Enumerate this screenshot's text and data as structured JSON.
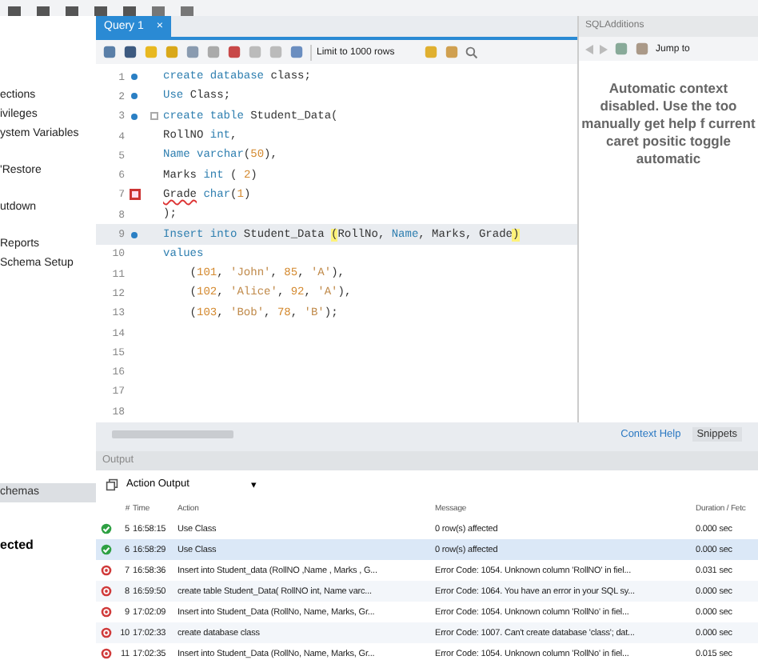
{
  "sidebar": {
    "groups": [
      {
        "items": [
          {
            "label": "ections"
          },
          {
            "label": "ivileges"
          },
          {
            "label": "ystem Variables"
          }
        ]
      },
      {
        "items": [
          {
            "label": "'Restore"
          }
        ]
      },
      {
        "items": [
          {
            "label": "utdown"
          }
        ]
      },
      {
        "items": [
          {
            "label": "Reports"
          },
          {
            "label": "Schema Setup"
          }
        ]
      }
    ],
    "schemas_tab": "chemas",
    "status": "ected"
  },
  "query_tab": {
    "label": "Query 1",
    "close": "×",
    "selected": true
  },
  "editor_toolbar": {
    "limit": "Limit to 1000 rows"
  },
  "lines": [
    {
      "n": "1",
      "kind": "statement",
      "tokens": [
        {
          "text": "create database ",
          "kind": "keyword"
        },
        {
          "text": "class;",
          "kind": "plain"
        }
      ]
    },
    {
      "n": "2",
      "kind": "statement",
      "tokens": [
        {
          "text": "Use ",
          "kind": "keyword"
        },
        {
          "text": "Class;",
          "kind": "plain"
        }
      ]
    },
    {
      "n": "3",
      "kind": "statement",
      "fold": true,
      "tokens": [
        {
          "text": "create table ",
          "kind": "keyword"
        },
        {
          "text": "Student_Data(",
          "kind": "plain"
        }
      ]
    },
    {
      "n": "4",
      "kind": "plain",
      "tokens": [
        {
          "text": "RollNO ",
          "kind": "plain"
        },
        {
          "text": "int",
          "kind": "keyword"
        },
        {
          "text": ",",
          "kind": "plain"
        }
      ]
    },
    {
      "n": "5",
      "kind": "plain",
      "tokens": [
        {
          "text": "Name ",
          "kind": "keyword"
        },
        {
          "text": "varchar",
          "kind": "keyword"
        },
        {
          "text": "(",
          "kind": "plain"
        },
        {
          "text": "50",
          "kind": "number"
        },
        {
          "text": "),",
          "kind": "plain"
        }
      ]
    },
    {
      "n": "6",
      "kind": "plain",
      "tokens": [
        {
          "text": "Marks ",
          "kind": "plain"
        },
        {
          "text": "int",
          "kind": "keyword"
        },
        {
          "text": " ( ",
          "kind": "plain"
        },
        {
          "text": "2",
          "kind": "number"
        },
        {
          "text": ")",
          "kind": "plain"
        }
      ]
    },
    {
      "n": "7",
      "kind": "error",
      "tokens": [
        {
          "text": "Grade",
          "kind": "error"
        },
        {
          "text": " char",
          "kind": "keyword"
        },
        {
          "text": "(",
          "kind": "plain"
        },
        {
          "text": "1",
          "kind": "number"
        },
        {
          "text": ")",
          "kind": "plain"
        }
      ]
    },
    {
      "n": "8",
      "kind": "plain",
      "tokens": [
        {
          "text": ");",
          "kind": "plain"
        }
      ]
    },
    {
      "n": "9",
      "kind": "statement",
      "current": true,
      "tokens": [
        {
          "text": "Insert into ",
          "kind": "keyword"
        },
        {
          "text": "Student_Data ",
          "kind": "plain"
        },
        {
          "text": "(",
          "kind": "match"
        },
        {
          "text": "RollNo, ",
          "kind": "plain"
        },
        {
          "text": "Name",
          "kind": "keyword"
        },
        {
          "text": ", Marks, Grade",
          "kind": "plain"
        },
        {
          "text": ")",
          "kind": "match"
        }
      ]
    },
    {
      "n": "10",
      "kind": "plain",
      "tokens": [
        {
          "text": "values",
          "kind": "keyword"
        }
      ]
    },
    {
      "n": "11",
      "kind": "plain",
      "tokens": [
        {
          "text": "    (",
          "kind": "plain"
        },
        {
          "text": "101",
          "kind": "number"
        },
        {
          "text": ", ",
          "kind": "plain"
        },
        {
          "text": "'John'",
          "kind": "string"
        },
        {
          "text": ", ",
          "kind": "plain"
        },
        {
          "text": "85",
          "kind": "number"
        },
        {
          "text": ", ",
          "kind": "plain"
        },
        {
          "text": "'A'",
          "kind": "string"
        },
        {
          "text": "),",
          "kind": "plain"
        }
      ]
    },
    {
      "n": "12",
      "kind": "plain",
      "tokens": [
        {
          "text": "    (",
          "kind": "plain"
        },
        {
          "text": "102",
          "kind": "number"
        },
        {
          "text": ", ",
          "kind": "plain"
        },
        {
          "text": "'Alice'",
          "kind": "string"
        },
        {
          "text": ", ",
          "kind": "plain"
        },
        {
          "text": "92",
          "kind": "number"
        },
        {
          "text": ", ",
          "kind": "plain"
        },
        {
          "text": "'A'",
          "kind": "string"
        },
        {
          "text": "),",
          "kind": "plain"
        }
      ]
    },
    {
      "n": "13",
      "kind": "plain",
      "tokens": [
        {
          "text": "    (",
          "kind": "plain"
        },
        {
          "text": "103",
          "kind": "number"
        },
        {
          "text": ", ",
          "kind": "plain"
        },
        {
          "text": "'Bob'",
          "kind": "string"
        },
        {
          "text": ", ",
          "kind": "plain"
        },
        {
          "text": "78",
          "kind": "number"
        },
        {
          "text": ", ",
          "kind": "plain"
        },
        {
          "text": "'B'",
          "kind": "string"
        },
        {
          "text": ");",
          "kind": "plain"
        }
      ]
    },
    {
      "n": "14",
      "kind": "plain"
    },
    {
      "n": "15",
      "kind": "plain"
    },
    {
      "n": "16",
      "kind": "plain"
    },
    {
      "n": "17",
      "kind": "plain"
    },
    {
      "n": "18",
      "kind": "plain"
    }
  ],
  "sql_additions": {
    "title": "SQLAdditions",
    "jump": "Jump to",
    "message": "Automatic context disabled. Use the too manually get help f current caret positic toggle automatic",
    "tabs": [
      {
        "label": "Context Help",
        "selected": true
      },
      {
        "label": "Snippets",
        "selected": false
      }
    ]
  },
  "output": {
    "title": "Output",
    "selector": "Action Output",
    "selector_caret": "▾",
    "columns": [
      "#",
      "Time",
      "Action",
      "Message",
      "Duration / Fetc"
    ],
    "rows": [
      {
        "kind": "ok",
        "n": "5",
        "time": "16:58:15",
        "action": "Use Class",
        "message": "0 row(s) affected",
        "duration": "0.000 sec",
        "selected": false
      },
      {
        "kind": "ok",
        "n": "6",
        "time": "16:58:29",
        "action": "Use Class",
        "message": "0 row(s) affected",
        "duration": "0.000 sec",
        "selected": true
      },
      {
        "kind": "error",
        "n": "7",
        "time": "16:58:36",
        "action": "Insert into Student_data (RollNO ,Name , Marks , G...",
        "message": "Error Code: 1054. Unknown column 'RollNO' in fiel...",
        "duration": "0.031 sec",
        "selected": false
      },
      {
        "kind": "error",
        "n": "8",
        "time": "16:59:50",
        "action": "create table Student_Data( RollNO int, Name varc...",
        "message": "Error Code: 1064. You have an error in your SQL sy...",
        "duration": "0.000 sec",
        "selected": false
      },
      {
        "kind": "error",
        "n": "9",
        "time": "17:02:09",
        "action": "Insert into Student_Data (RollNo, Name, Marks, Gr...",
        "message": "Error Code: 1054. Unknown column 'RollNo' in fiel...",
        "duration": "0.000 sec",
        "selected": false
      },
      {
        "kind": "error",
        "n": "10",
        "time": "17:02:33",
        "action": "create database class",
        "message": "Error Code: 1007. Can't create database 'class'; dat...",
        "duration": "0.000 sec",
        "selected": false
      },
      {
        "kind": "error",
        "n": "11",
        "time": "17:02:35",
        "action": "Insert into Student_Data (RollNo, Name, Marks, Gr...",
        "message": "Error Code: 1054. Unknown column 'RollNo' in fiel...",
        "duration": "0.015 sec",
        "selected": false
      }
    ]
  }
}
